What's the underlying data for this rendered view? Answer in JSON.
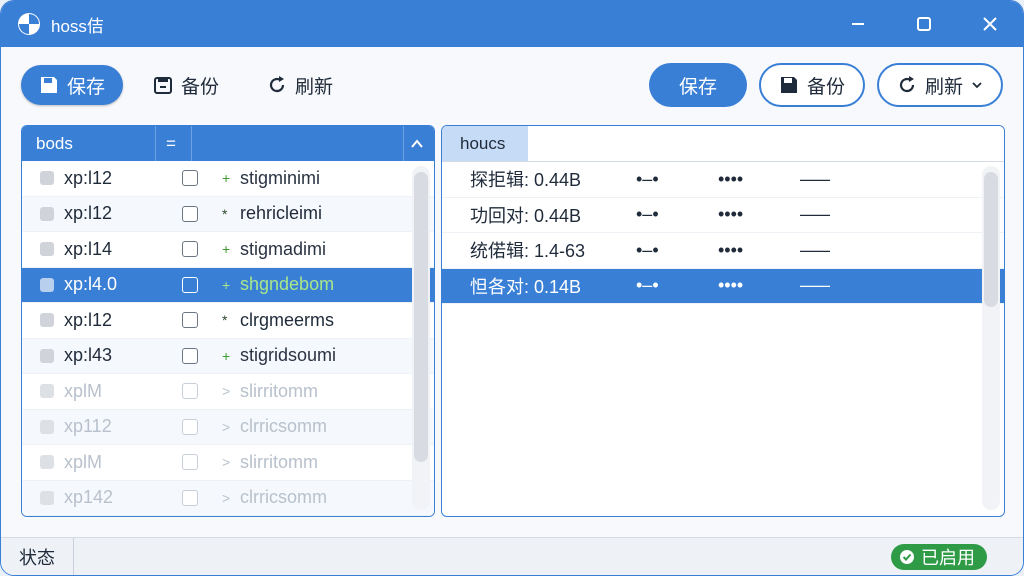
{
  "app": {
    "title": "hoss佶"
  },
  "toolbar": {
    "left": [
      {
        "label": "保存",
        "icon": "save-icon",
        "primary": true
      },
      {
        "label": "备份",
        "icon": "backup-icon",
        "primary": false
      },
      {
        "label": "刷新",
        "icon": "refresh-icon",
        "primary": false
      }
    ],
    "right": {
      "save": "保存",
      "backup": "备份",
      "refresh": "刷新"
    }
  },
  "left_pane": {
    "headers": [
      "bods",
      "="
    ],
    "rows": [
      {
        "name": "xp:l12",
        "mark": "+",
        "desc": "stigminimi",
        "green": true
      },
      {
        "name": "xp:l12",
        "mark": "*",
        "desc": "rehricleimi",
        "green": false
      },
      {
        "name": "xp:l14",
        "mark": "+",
        "desc": "stigmadimi",
        "green": true
      },
      {
        "name": "xp:l4.0",
        "mark": "+",
        "desc": "shgndebom",
        "green": true,
        "selected": true
      },
      {
        "name": "xp:l12",
        "mark": "*",
        "desc": "clrgmeerms",
        "green": false
      },
      {
        "name": "xp:l43",
        "mark": "+",
        "desc": "stigridsoumi",
        "green": true
      },
      {
        "name": "xplM",
        "mark": ">",
        "desc": "slirritomm",
        "faded": true
      },
      {
        "name": "xp112",
        "mark": ">",
        "desc": "clrricsomm",
        "faded": true
      },
      {
        "name": "xplM",
        "mark": ">",
        "desc": "slirritomm",
        "faded": true
      },
      {
        "name": "xp142",
        "mark": ">",
        "desc": "clrricsomm",
        "faded": true
      }
    ]
  },
  "right_pane": {
    "header": "houcs",
    "rows": [
      {
        "label": "探拒辑: 0.44B",
        "c1": "•–•",
        "c2": "••••",
        "c3": "–––"
      },
      {
        "label": "功回对: 0.44B",
        "c1": "•–•",
        "c2": "••••",
        "c3": "–––"
      },
      {
        "label": "统偌辑: 1.4-63",
        "c1": "•–•",
        "c2": "••••",
        "c3": "–––"
      },
      {
        "label": "怛各对: 0.14B",
        "c1": "•–•",
        "c2": "••••",
        "c3": "–––",
        "selected": true
      }
    ]
  },
  "status": {
    "label": "状态",
    "badge": "已启用"
  },
  "colors": {
    "accent": "#3a7fd6",
    "success": "#2f9b47"
  }
}
